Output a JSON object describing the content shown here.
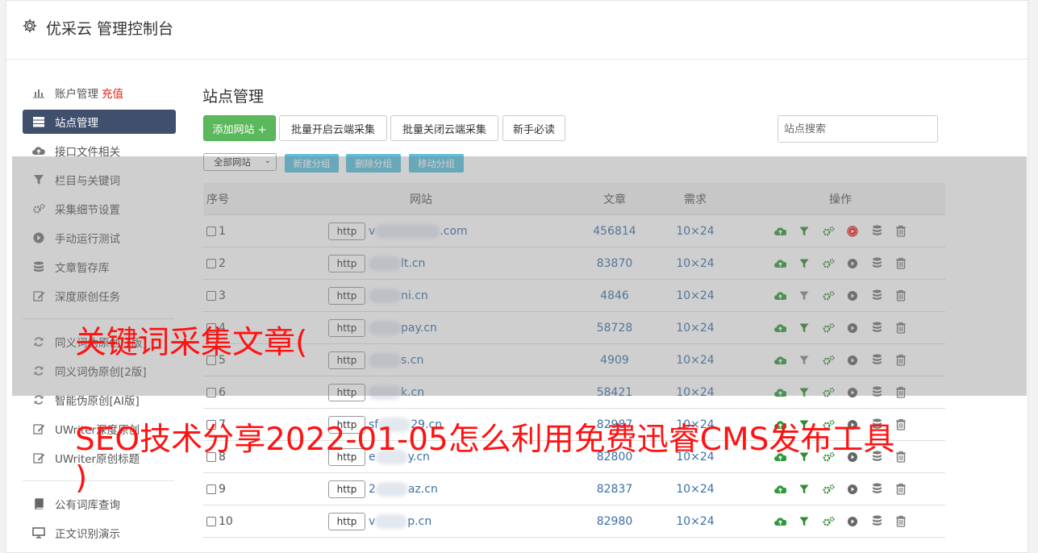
{
  "header": {
    "title": "优采云 管理控制台",
    "icon": "gear-icon"
  },
  "sidebar": {
    "items": [
      {
        "label": "账户管理",
        "extra": "充值",
        "icon": "bar-chart-icon"
      },
      {
        "label": "站点管理",
        "icon": "server-icon",
        "active": true
      },
      {
        "label": "接口文件相关",
        "icon": "cloud-upload-icon"
      },
      {
        "label": "栏目与关键词",
        "icon": "filter-icon"
      },
      {
        "label": "采集细节设置",
        "icon": "cogs-icon"
      },
      {
        "label": "手动运行测试",
        "icon": "play-circle-icon"
      },
      {
        "label": "文章暂存库",
        "icon": "database-icon"
      },
      {
        "label": "深度原创任务",
        "icon": "edit-icon"
      }
    ],
    "items2": [
      {
        "label": "同义词伪原创[1版]",
        "icon": "refresh-icon"
      },
      {
        "label": "同义词伪原创[2版]",
        "icon": "refresh-icon"
      },
      {
        "label": "智能伪原创[AI版]",
        "icon": "refresh-icon"
      },
      {
        "label": "UWriter深度原创",
        "icon": "edit-icon"
      },
      {
        "label": "UWriter原创标题",
        "icon": "edit-icon"
      }
    ],
    "items3": [
      {
        "label": "公有词库查询",
        "icon": "book-icon"
      },
      {
        "label": "正文识别演示",
        "icon": "monitor-icon"
      }
    ]
  },
  "main": {
    "title": "站点管理",
    "toolbar": {
      "add_site": "添加网站 +",
      "batch_open": "批量开启云端采集",
      "batch_close": "批量关闭云端采集",
      "newbie": "新手必读"
    },
    "search": {
      "placeholder": "站点搜索"
    },
    "group": {
      "select": "全部网站",
      "new_group": "新建分组",
      "delete_group": "删除分组",
      "move_group": "移动分组"
    },
    "table": {
      "headers": {
        "no": "序号",
        "site": "网站",
        "articles": "文章",
        "demand": "需求",
        "ops": "操作"
      },
      "http_label": "http",
      "rows": [
        {
          "no": "1",
          "domain_prefix": "v",
          "domain": ".com",
          "articles": "456814",
          "demand": "10×24",
          "active_play": true,
          "filter_active": true
        },
        {
          "no": "2",
          "domain_prefix": "",
          "domain": "lt.cn",
          "articles": "83870",
          "demand": "10×24",
          "active_play": false,
          "filter_active": true
        },
        {
          "no": "3",
          "domain_prefix": "",
          "domain": "ni.cn",
          "articles": "4846",
          "demand": "10×24",
          "active_play": false,
          "filter_active": false
        },
        {
          "no": "4",
          "domain_prefix": "",
          "domain": "pay.cn",
          "articles": "58728",
          "demand": "10×24",
          "active_play": false,
          "filter_active": true
        },
        {
          "no": "5",
          "domain_prefix": "",
          "domain": "s.cn",
          "articles": "4909",
          "demand": "10×24",
          "active_play": false,
          "filter_active": false
        },
        {
          "no": "6",
          "domain_prefix": "",
          "domain": "k.cn",
          "articles": "58421",
          "demand": "10×24",
          "active_play": false,
          "filter_active": true
        },
        {
          "no": "7",
          "domain_prefix": "sf",
          "domain": "29.cn",
          "articles": "82987",
          "demand": "10×24",
          "active_play": false,
          "filter_active": true
        },
        {
          "no": "8",
          "domain_prefix": "e",
          "domain": "y.cn",
          "articles": "82800",
          "demand": "10×24",
          "active_play": false,
          "filter_active": true
        },
        {
          "no": "9",
          "domain_prefix": "2",
          "domain": "az.cn",
          "articles": "82837",
          "demand": "10×24",
          "active_play": false,
          "filter_active": true
        },
        {
          "no": "10",
          "domain_prefix": "v",
          "domain": "p.cn",
          "articles": "82980",
          "demand": "10×24",
          "active_play": false,
          "filter_active": true
        }
      ]
    }
  },
  "watermark": {
    "line1": "关键词采集文章(",
    "line2": "SEO技术分享2022-01-05怎么利用免费迅睿CMS发布工具",
    "line3": ")"
  },
  "colors": {
    "accent": "#3f4f6c",
    "green": "#5cb85c",
    "info": "#5bc0de",
    "link": "#3b6fa6",
    "watermark": "#ff1212",
    "play_active": "#e2231a"
  }
}
